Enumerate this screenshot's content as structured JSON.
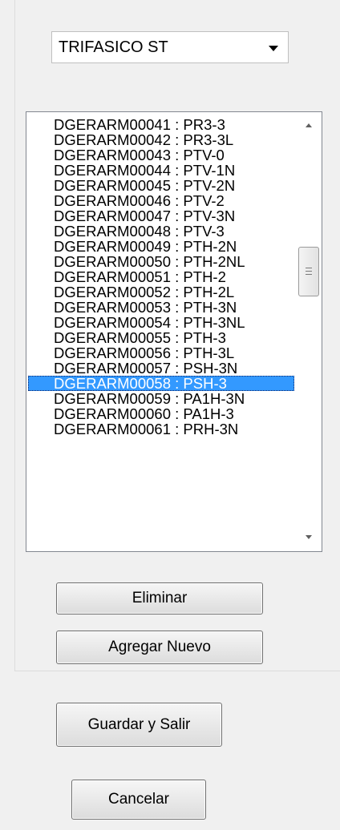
{
  "combo": {
    "selected": "TRIFASICO ST"
  },
  "list": {
    "items": [
      "DGERARM00041 : PR3-3",
      "DGERARM00042 : PR3-3L",
      "DGERARM00043 : PTV-0",
      "DGERARM00044 : PTV-1N",
      "DGERARM00045 : PTV-2N",
      "DGERARM00046 : PTV-2",
      "DGERARM00047 : PTV-3N",
      "DGERARM00048 : PTV-3",
      "DGERARM00049 : PTH-2N",
      "DGERARM00050 : PTH-2NL",
      "DGERARM00051 : PTH-2",
      "DGERARM00052 : PTH-2L",
      "DGERARM00053 : PTH-3N",
      "DGERARM00054 : PTH-3NL",
      "DGERARM00055 : PTH-3",
      "DGERARM00056 : PTH-3L",
      "DGERARM00057 : PSH-3N",
      "DGERARM00058 : PSH-3",
      "DGERARM00059 : PA1H-3N",
      "DGERARM00060 : PA1H-3",
      "DGERARM00061 : PRH-3N"
    ],
    "selected_item": "DGERARM00058 : PSH-3",
    "selection_color": "#3399ff"
  },
  "buttons": {
    "eliminar": "Eliminar",
    "agregar": "Agregar Nuevo",
    "guardar": "Guardar y Salir",
    "cancelar": "Cancelar"
  },
  "icons": {
    "combo_arrow": "chevron-down-icon",
    "scroll_up": "scroll-up-arrow-icon",
    "scroll_down": "scroll-down-arrow-icon",
    "scroll_thumb": "scroll-thumb-grip-icon"
  }
}
